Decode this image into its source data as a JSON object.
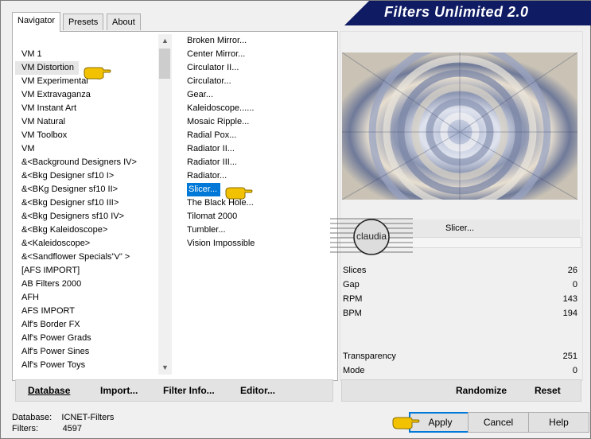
{
  "title": "Filters Unlimited 2.0",
  "tabs": [
    "Navigator",
    "Presets",
    "About"
  ],
  "categories": [
    "VM 1",
    "VM Distortion",
    "VM Experimental",
    "VM Extravaganza",
    "VM Instant Art",
    "VM Natural",
    "VM Toolbox",
    "VM",
    "&<Background Designers IV>",
    "&<Bkg Designer sf10 I>",
    "&<BKg Designer sf10 II>",
    "&<Bkg Designer sf10 III>",
    "&<Bkg Designers sf10 IV>",
    "&<Bkg Kaleidoscope>",
    "&<Kaleidoscope>",
    "&<Sandflower Specials\"v\" >",
    "[AFS IMPORT]",
    "AB Filters 2000",
    "AFH",
    "AFS IMPORT",
    "Alf's Border FX",
    "Alf's Power Grads",
    "Alf's Power Sines",
    "Alf's Power Toys"
  ],
  "filters": [
    "Broken Mirror...",
    "Center Mirror...",
    "Circulator II...",
    "Circulator...",
    "Gear...",
    "Kaleidoscope......",
    "Mosaic Ripple...",
    "Radial Pox...",
    "Radiator II...",
    "Radiator III...",
    "Radiator...",
    "Slicer...",
    "The Black Hole...",
    "Tilomat 2000",
    "Tumbler...",
    "Vision Impossible"
  ],
  "selected_filter_name": "Slicer...",
  "logo_text": "claudia",
  "params": [
    {
      "name": "Slices",
      "value": "26"
    },
    {
      "name": "Gap",
      "value": "0"
    },
    {
      "name": "RPM",
      "value": "143"
    },
    {
      "name": "BPM",
      "value": "194"
    },
    {
      "name": "Transparency",
      "value": "251"
    },
    {
      "name": "Mode",
      "value": "0"
    }
  ],
  "bottom_left": {
    "database": "Database",
    "import": "Import...",
    "filter_info": "Filter Info...",
    "editor": "Editor..."
  },
  "bottom_right": {
    "randomize": "Randomize",
    "reset": "Reset"
  },
  "status": {
    "database_label": "Database:",
    "database_value": "ICNET-Filters",
    "filters_label": "Filters:",
    "filters_value": "4597"
  },
  "buttons": {
    "apply": "Apply",
    "cancel": "Cancel",
    "help": "Help"
  },
  "colors": {
    "title_bg": "#0f1b63",
    "selection": "#0078d7",
    "hand": "#f2c200"
  }
}
